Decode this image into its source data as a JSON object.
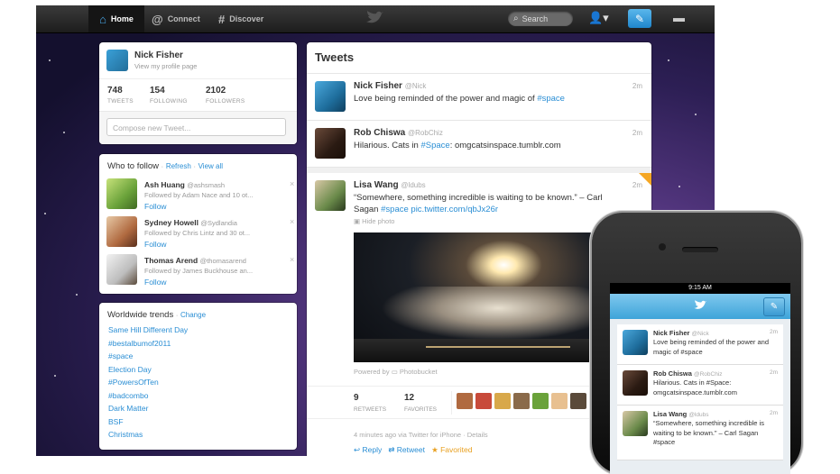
{
  "topbar": {
    "home_label": "Home",
    "connect_label": "Connect",
    "discover_label": "Discover",
    "search_placeholder": "Search"
  },
  "profile": {
    "name": "Nick Fisher",
    "view_profile": "View my profile page",
    "stats": [
      {
        "value": "748",
        "label": "TWEETS"
      },
      {
        "value": "154",
        "label": "FOLLOWING"
      },
      {
        "value": "2102",
        "label": "FOLLOWERS"
      }
    ],
    "compose_placeholder": "Compose new Tweet..."
  },
  "who_to_follow": {
    "title": "Who to follow",
    "refresh": "Refresh",
    "view_all": "View all",
    "separator": "·",
    "users": [
      {
        "name": "Ash Huang",
        "handle": "@ashsmash",
        "followed_by": "Followed by Adam Nace and 10 ot...",
        "follow": "Follow",
        "dismiss": "×"
      },
      {
        "name": "Sydney Howell",
        "handle": "@Sydlandia",
        "followed_by": "Followed by Chris Lintz and 30 ot...",
        "follow": "Follow",
        "dismiss": "×"
      },
      {
        "name": "Thomas Arend",
        "handle": "@thomasarend",
        "followed_by": "Followed by James Buckhouse an...",
        "follow": "Follow",
        "dismiss": "×"
      }
    ]
  },
  "trends": {
    "title": "Worldwide trends",
    "separator": "·",
    "change": "Change",
    "items": [
      "Same Hill Different Day",
      "#bestalbumof2011",
      "#space",
      "Election Day",
      "#PowersOfTen",
      "#badcombo",
      "Dark Matter",
      "BSF",
      "Christmas"
    ]
  },
  "tweets": {
    "title": "Tweets",
    "list": [
      {
        "name": "Nick Fisher",
        "handle": "@Nick",
        "text": "Love being reminded of the power and magic of ",
        "hashtag": "#space",
        "time": "2m"
      },
      {
        "name": "Rob Chiswa",
        "handle": "@RobChiz",
        "text": "Hilarious. Cats in ",
        "hashtag": "#Space",
        "text2": ": omgcatsinspace.tumblr.com",
        "time": "2m"
      }
    ],
    "expanded": {
      "name": "Lisa Wang",
      "handle": "@ldubs",
      "text_line1": "“Somewhere, something incredible is waiting to be known.” – Carl",
      "text_line2": "Sagan ",
      "hashtag": "#space",
      "link": "pic.twitter.com/qbJx26r",
      "hide_photo": "Hide photo",
      "powered_by": "Powered by",
      "provider": "Photobucket",
      "retweets": "9",
      "retweets_label": "RETWEETS",
      "favorites": "12",
      "favorites_label": "FAVORITES",
      "meta": "4 minutes ago via Twitter for iPhone · Details",
      "reply": "Reply",
      "retweet": "Retweet",
      "favorited": "Favorited",
      "time": "2m"
    }
  },
  "phone": {
    "time": "9:15 AM",
    "tweets": [
      {
        "name": "Nick Fisher",
        "handle": "@Nick",
        "text": "Love being reminded of the power and magic of #space",
        "time": "2m"
      },
      {
        "name": "Rob Chiswa",
        "handle": "@RobChiz",
        "text": "Hilarious. Cats in #Space: omgcatsinspace.tumblr.com",
        "time": "2m"
      },
      {
        "name": "Lisa Wang",
        "handle": "@ldubs",
        "text": "“Somewhere, something incredible is waiting to be known.” – Carl Sagan #space",
        "time": "2m"
      }
    ]
  },
  "colors": {
    "accent": "#2a8ed4",
    "topbar": "#222222",
    "favorited": "#e8a020"
  }
}
